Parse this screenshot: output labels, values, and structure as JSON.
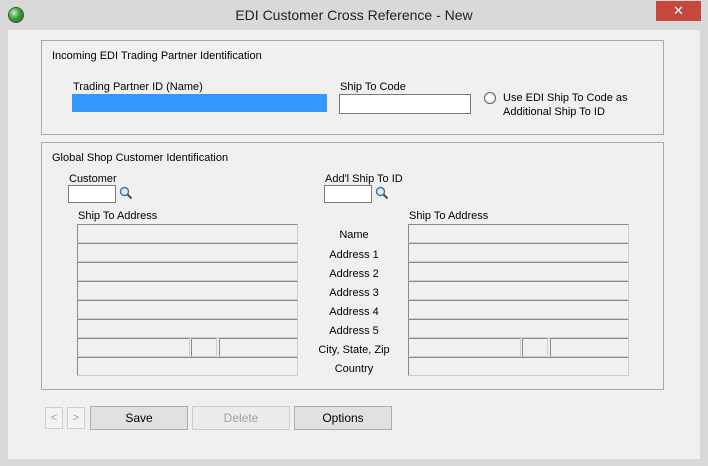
{
  "window": {
    "title": "EDI Customer Cross Reference - New",
    "close_glyph": "✕"
  },
  "incoming": {
    "group_title": "Incoming EDI Trading Partner Identification",
    "trading_partner_label": "Trading Partner ID (Name)",
    "trading_partner_value": "",
    "ship_to_code_label": "Ship To Code",
    "ship_to_code_value": "",
    "use_edi_line1": "Use EDI Ship To Code as",
    "use_edi_line2": "Additional Ship To ID"
  },
  "global": {
    "group_title": "Global Shop Customer Identification",
    "customer_label": "Customer",
    "addl_ship_to_label": "Add'l Ship To ID",
    "left_address_header": "Ship To Address",
    "right_address_header": "Ship To Address",
    "rows": [
      "Name",
      "Address 1",
      "Address 2",
      "Address 3",
      "Address 4",
      "Address 5",
      "City, State, Zip",
      "Country"
    ]
  },
  "footer": {
    "prev": "<",
    "next": ">",
    "save": "Save",
    "delete": "Delete",
    "options": "Options"
  },
  "icons": {
    "search": "magnifier-icon",
    "app": "globe-icon"
  }
}
